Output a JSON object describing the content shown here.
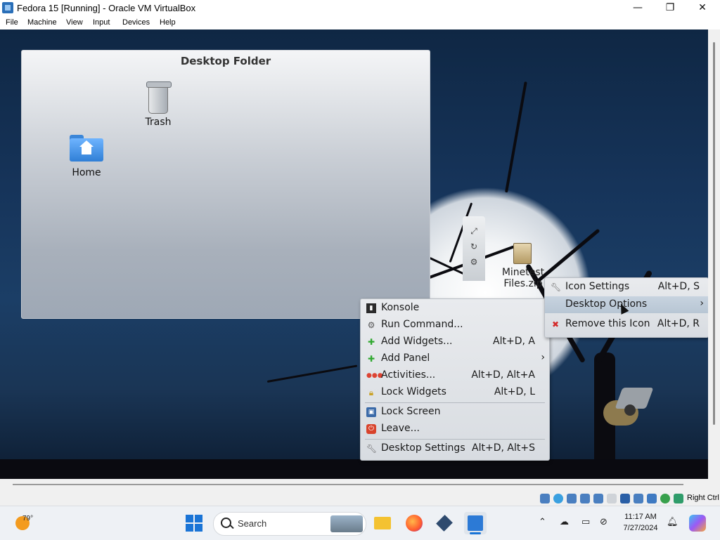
{
  "window": {
    "title": "Fedora 15 [Running] - Oracle VM VirtualBox",
    "controls": {
      "minimize": "—",
      "maximize": "❐",
      "close": "✕"
    }
  },
  "menubar": [
    "File",
    "Machine",
    "View",
    "Input",
    "Devices",
    "Help"
  ],
  "desktop": {
    "folder_title": "Desktop Folder",
    "folder_icons": [
      {
        "label": "Trash",
        "icon": "trash-icon"
      },
      {
        "label": "Home",
        "icon": "home-folder-icon"
      }
    ],
    "desktop_file": {
      "label_line1": "Minetest",
      "label_line2": "Files.zip",
      "icon": "zip-archive-icon"
    }
  },
  "context_menu": {
    "items": [
      {
        "label": "Konsole",
        "shortcut": "",
        "icon": "terminal-icon"
      },
      {
        "label": "Run Command...",
        "shortcut": "",
        "icon": "run-icon"
      },
      {
        "label": "Add Widgets...",
        "shortcut": "Alt+D, A",
        "icon": "plus-icon"
      },
      {
        "label": "Add Panel",
        "shortcut": "",
        "icon": "plus-icon",
        "submenu": true
      },
      {
        "label": "Activities...",
        "shortcut": "Alt+D, Alt+A",
        "icon": "activities-icon"
      },
      {
        "label": "Lock Widgets",
        "shortcut": "Alt+D, L",
        "icon": "lock-icon"
      },
      {
        "label": "Lock Screen",
        "shortcut": "",
        "icon": "lock-screen-icon"
      },
      {
        "label": "Leave...",
        "shortcut": "",
        "icon": "power-icon"
      },
      {
        "label": "Desktop Settings",
        "shortcut": "Alt+D, Alt+S",
        "icon": "wrench-icon"
      }
    ]
  },
  "sub_menu": {
    "items": [
      {
        "label": "Icon Settings",
        "shortcut": "Alt+D, S",
        "icon": "wrench-icon"
      },
      {
        "label": "Desktop Options",
        "shortcut": "",
        "icon": "",
        "submenu": true
      },
      {
        "label": "Remove this Icon",
        "shortcut": "Alt+D, R",
        "icon": "remove-icon"
      }
    ]
  },
  "statusbar": {
    "host_key": "Right Ctrl"
  },
  "taskbar": {
    "weather": "79°",
    "search_placeholder": "Search",
    "time": "11:17 AM",
    "date": "7/27/2024"
  }
}
